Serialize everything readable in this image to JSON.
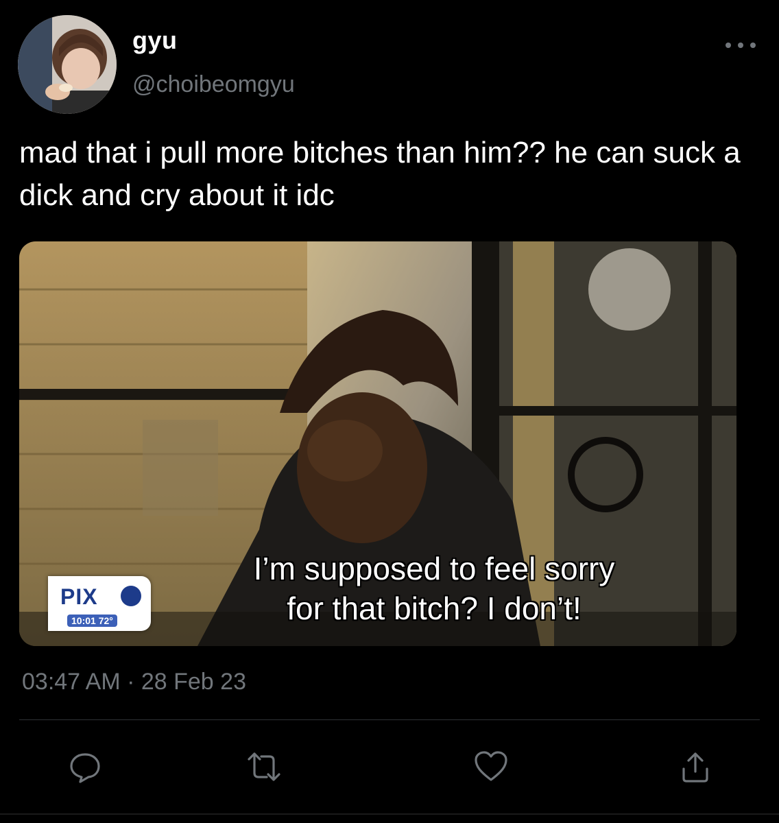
{
  "author": {
    "display_name": "gyu",
    "handle": "@choibeomgyu",
    "avatar_icon": "profile-photo"
  },
  "tweet": {
    "text": "mad that i pull more bitches than him?? he can suck a dick and cry about it idc",
    "media": {
      "caption_line1": "I’m supposed to feel sorry",
      "caption_line2": "for that bitch?  I don’t!",
      "logo_text": "PIX",
      "logo_time": "10:01 72°"
    },
    "timestamp": "03:47 AM · 28 Feb 23"
  },
  "actions": [
    {
      "name": "reply",
      "icon": "comment-icon"
    },
    {
      "name": "retweet",
      "icon": "retweet-icon"
    },
    {
      "name": "like",
      "icon": "heart-icon"
    },
    {
      "name": "share",
      "icon": "share-icon"
    }
  ],
  "colors": {
    "background": "#000000",
    "primary_text": "#ffffff",
    "secondary_text": "#71767b",
    "divider": "#2f3336"
  }
}
